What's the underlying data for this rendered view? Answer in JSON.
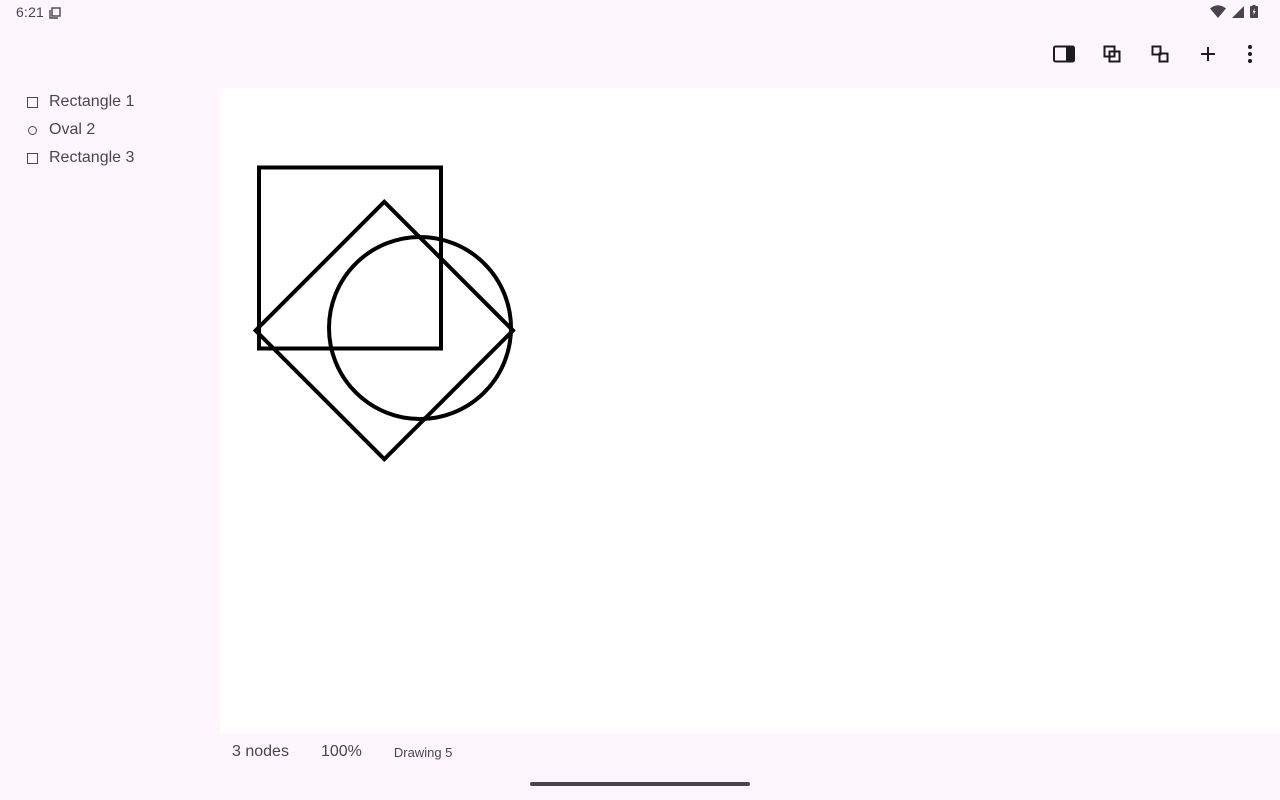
{
  "status_bar": {
    "time": "6:21",
    "notification_icon": "screenshot-icon",
    "right_icons": [
      "wifi-icon",
      "signal-icon",
      "battery-icon"
    ]
  },
  "toolbar": {
    "buttons": [
      {
        "icon": "side-panel-icon"
      },
      {
        "icon": "group-icon"
      },
      {
        "icon": "ungroup-icon"
      },
      {
        "icon": "add-icon"
      },
      {
        "icon": "more-vert-icon"
      }
    ]
  },
  "layers": [
    {
      "label": "Rectangle 1",
      "icon": "square-outline-icon"
    },
    {
      "label": "Oval 2",
      "icon": "circle-outline-icon"
    },
    {
      "label": "Rectangle 3",
      "icon": "square-outline-icon"
    }
  ],
  "footer": {
    "nodes": "3 nodes",
    "zoom": "100%",
    "document": "Drawing 5"
  },
  "colors": {
    "background": "#fdf7fd",
    "canvas": "#ffffff",
    "stroke": "#000000",
    "text": "#49454f"
  }
}
